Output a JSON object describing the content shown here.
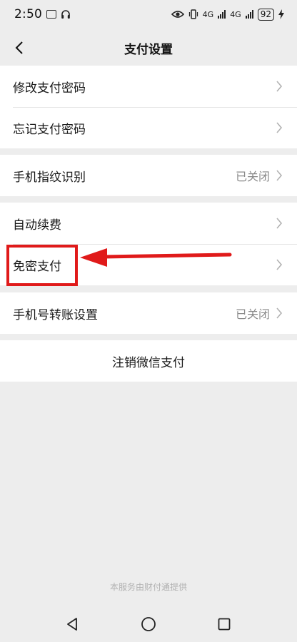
{
  "status": {
    "time": "2:50",
    "battery": "92",
    "net1": "4G",
    "net2": "4G"
  },
  "nav": {
    "title": "支付设置",
    "back_icon": "chevron-left-icon"
  },
  "groups": [
    {
      "items": [
        {
          "label": "修改支付密码",
          "value": ""
        },
        {
          "label": "忘记支付密码",
          "value": ""
        }
      ]
    },
    {
      "items": [
        {
          "label": "手机指纹识别",
          "value": "已关闭"
        }
      ]
    },
    {
      "items": [
        {
          "label": "自动续费",
          "value": ""
        },
        {
          "label": "免密支付",
          "value": ""
        }
      ]
    },
    {
      "items": [
        {
          "label": "手机号转账设置",
          "value": "已关闭"
        }
      ]
    }
  ],
  "cancel": {
    "label": "注销微信支付"
  },
  "footer": {
    "text": "本服务由财付通提供"
  },
  "annotation": {
    "color": "#e01a1a",
    "target": "免密支付"
  },
  "colors": {
    "background": "#ededed",
    "card": "#ffffff",
    "secondary_text": "#8a8a8a"
  }
}
